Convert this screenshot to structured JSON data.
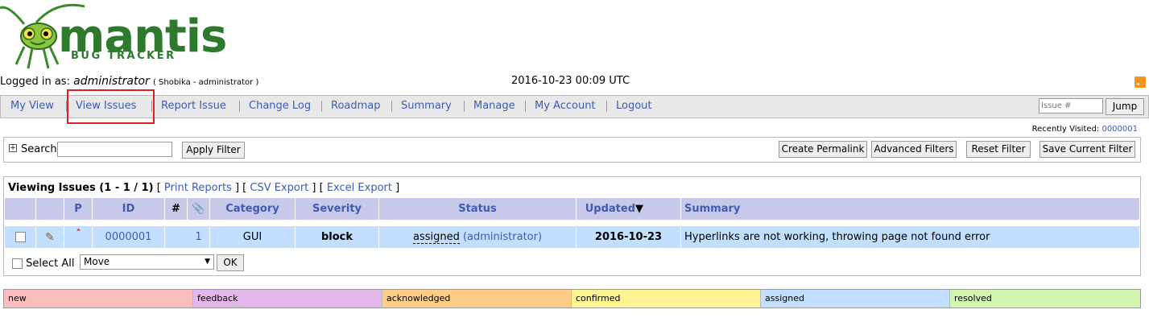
{
  "logo": {
    "wordmark": "mantis",
    "subtitle": "BUG TRACKER"
  },
  "login": {
    "prefix": "Logged in as:",
    "username": "administrator",
    "realname": "( Shobika - administrator )",
    "datetime": "2016-10-23 00:09 UTC"
  },
  "menu": {
    "items": [
      "My View",
      "View Issues",
      "Report Issue",
      "Change Log",
      "Roadmap",
      "Summary",
      "Manage",
      "My Account",
      "Logout"
    ],
    "jump_placeholder": "Issue #",
    "jump_label": "Jump"
  },
  "recent": {
    "label": "Recently Visited:",
    "link": "0000001"
  },
  "filter": {
    "search_label": "Search",
    "apply_label": "Apply Filter",
    "create_permalink": "Create Permalink",
    "advanced_filters": "Advanced Filters",
    "reset_filter": "Reset Filter",
    "save_filter": "Save Current Filter"
  },
  "issues": {
    "viewing_label": "Viewing Issues (1 - 1 / 1)",
    "print_reports": "Print Reports",
    "csv_export": "CSV Export",
    "excel_export": "Excel Export",
    "columns": {
      "p": "P",
      "id": "ID",
      "notes": "#",
      "category": "Category",
      "severity": "Severity",
      "status": "Status",
      "updated": "Updated",
      "summary": "Summary"
    },
    "rows": [
      {
        "id": "0000001",
        "notes": "1",
        "category": "GUI",
        "severity": "block",
        "status": "assigned",
        "handler": "(administrator)",
        "updated": "2016-10-23",
        "summary": "Hyperlinks are not working, throwing page not found error"
      }
    ],
    "select_all": "Select All",
    "action_value": "Move",
    "ok_label": "OK"
  },
  "legend": [
    {
      "label": "new",
      "color": "#fcbdbd"
    },
    {
      "label": "feedback",
      "color": "#e3b7eb"
    },
    {
      "label": "acknowledged",
      "color": "#ffcd85"
    },
    {
      "label": "confirmed",
      "color": "#fff494"
    },
    {
      "label": "assigned",
      "color": "#c2dfff"
    },
    {
      "label": "resolved",
      "color": "#d2f5b0"
    }
  ]
}
